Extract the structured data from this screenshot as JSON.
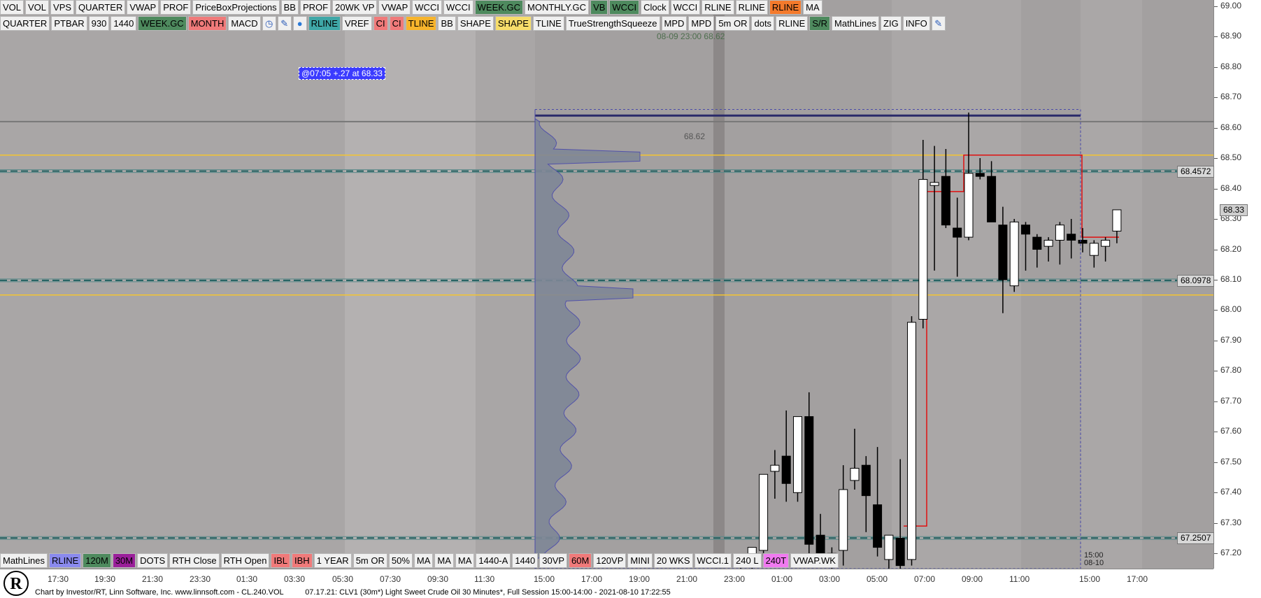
{
  "toolbar_top": [
    "VOL",
    "VOL",
    "VPS",
    "QUARTER",
    "VWAP",
    "PROF",
    "PriceBoxProjections",
    "BB",
    "PROF",
    "20WK VP",
    "VWAP",
    "WCCI",
    "WCCI",
    "WEEK.GC",
    "MONTHLY.GC",
    "VB",
    "WCCI",
    "Clock",
    "WCCI",
    "RLINE",
    "RLINE",
    "RLINE",
    "MA"
  ],
  "toolbar_top_colors": [
    "#f0f0f0",
    "#f0f0f0",
    "#f0f0f0",
    "#f0f0f0",
    "#f0f0f0",
    "#f0f0f0",
    "#f0f0f0",
    "#f0f0f0",
    "#f0f0f0",
    "#f0f0f0",
    "#f0f0f0",
    "#f0f0f0",
    "#f0f0f0",
    "#4e8a5e",
    "#f0f0f0",
    "#4e8a5e",
    "#4e8a5e",
    "#f0f0f0",
    "#f0f0f0",
    "#f0f0f0",
    "#f0f0f0",
    "#f47a2c",
    "#f0f0f0"
  ],
  "toolbar_second": [
    "QUARTER",
    "PTBAR",
    "930",
    "1440",
    "WEEK.GC",
    "MONTH",
    "MACD",
    "clock-icon",
    "pen-icon",
    "drop-icon",
    "RLINE",
    "VREF",
    "CI",
    "CI",
    "TLINE",
    "BB",
    "SHAPE",
    "SHAPE",
    "TLINE",
    "TrueStrengthSqueeze",
    "MPD",
    "MPD",
    "5m OR",
    "dots",
    "RLINE",
    "S/R",
    "MathLines",
    "ZIG",
    "INFO",
    "edit-icon"
  ],
  "toolbar_second_colors": [
    "#f0f0f0",
    "#f0f0f0",
    "#f0f0f0",
    "#f0f0f0",
    "#4e8a5e",
    "#f07a7a",
    "#f0f0f0",
    "#f0f0f0",
    "#f0f0f0",
    "#f0f0f0",
    "#3fa7a7",
    "#f0f0f0",
    "#f07a7a",
    "#f07a7a",
    "#f7b42c",
    "#f0f0f0",
    "#f0f0f0",
    "#f7dd6a",
    "#f0f0f0",
    "#f0f0f0",
    "#f0f0f0",
    "#f0f0f0",
    "#f0f0f0",
    "#f0f0f0",
    "#f0f0f0",
    "#4e8a5e",
    "#f0f0f0",
    "#f0f0f0",
    "#f0f0f0",
    "#f0f0f0"
  ],
  "toolbar_bottom": [
    "MathLines",
    "RLINE",
    "120M",
    "30M",
    "DOTS",
    "RTH Close",
    "RTH Open",
    "IBL",
    "IBH",
    "1 YEAR",
    "5m OR",
    "50%",
    "MA",
    "MA",
    "MA",
    "1440-A",
    "1440",
    "30VP",
    "60M",
    "120VP",
    "MINI",
    "20 WKS",
    "WCCI.1",
    "240 L",
    "240T",
    "VWAP.WK"
  ],
  "toolbar_bottom_colors": [
    "#f0f0f0",
    "#8a8aee",
    "#4e8a5e",
    "#9a1f9a",
    "#f0f0f0",
    "#f0f0f0",
    "#f0f0f0",
    "#f07a7a",
    "#f07a7a",
    "#f0f0f0",
    "#f0f0f0",
    "#f0f0f0",
    "#f0f0f0",
    "#f0f0f0",
    "#f0f0f0",
    "#f0f0f0",
    "#f0f0f0",
    "#f0f0f0",
    "#f07a7a",
    "#f0f0f0",
    "#f0f0f0",
    "#f0f0f0",
    "#f0f0f0",
    "#f0f0f0",
    "#f07af0",
    "#f0f0f0"
  ],
  "window_controls": [
    "⧉",
    "✕"
  ],
  "annotation_box": "@07:05  +.27 at 68.33",
  "crosshair_label": "08-09 23:00  68.62",
  "profile_high_label": "68.62",
  "time_marker": [
    "15:00",
    "08-10"
  ],
  "status_text": "Chart by Investor/RT, Linn Software, Inc. www.linnsoft.com - CL.240.VOL",
  "status_text_2": "07.17.21: CLV1 (30m*) Light Sweet Crude Oil 30 Minutes*, Full Session 15:00-14:00 - 2021-08-10 17:22:55",
  "price_tags": [
    {
      "label": "68.4572",
      "price": 68.4572,
      "bg": "#d8d8d8"
    },
    {
      "label": "68.33",
      "price": 68.33,
      "bg": "#cfcfcf"
    },
    {
      "label": "68.0978",
      "price": 68.0978,
      "bg": "#d8d8d8"
    },
    {
      "label": "67.2507",
      "price": 67.2507,
      "bg": "#d8d8d8"
    }
  ],
  "chart_data": {
    "type": "candlestick",
    "instrument": "CLV1 (30m*) Light Sweet Crude Oil 30 Minutes*",
    "ylim": [
      67.15,
      69.02
    ],
    "y_ticks": [
      "69.00",
      "68.90",
      "68.80",
      "68.70",
      "68.60",
      "68.50",
      "68.40",
      "68.30",
      "68.20",
      "68.10",
      "68.00",
      "67.90",
      "67.80",
      "67.70",
      "67.60",
      "67.50",
      "67.40",
      "67.30",
      "67.20"
    ],
    "x_ticks": [
      "17:30",
      "19:30",
      "21:30",
      "23:30",
      "01:30",
      "03:30",
      "05:30",
      "07:30",
      "09:30",
      "11:30",
      "15:00",
      "17:00",
      "19:00",
      "21:00",
      "23:00",
      "01:00",
      "03:00",
      "05:00",
      "07:00",
      "09:00",
      "11:00",
      "15:00",
      "17:00"
    ],
    "candles": [
      {
        "o": 67.16,
        "h": 67.17,
        "l": 67.15,
        "c": 67.17
      },
      {
        "o": 67.18,
        "h": 67.22,
        "l": 67.15,
        "c": 67.22
      },
      {
        "o": 67.21,
        "h": 67.46,
        "l": 67.19,
        "c": 67.46
      },
      {
        "o": 67.47,
        "h": 67.54,
        "l": 67.38,
        "c": 67.49
      },
      {
        "o": 67.52,
        "h": 67.67,
        "l": 67.37,
        "c": 67.43
      },
      {
        "o": 67.4,
        "h": 67.65,
        "l": 67.37,
        "c": 67.65
      },
      {
        "o": 67.65,
        "h": 67.73,
        "l": 67.18,
        "c": 67.23
      },
      {
        "o": 67.26,
        "h": 67.33,
        "l": 67.16,
        "c": 67.17
      },
      {
        "o": 67.17,
        "h": 67.22,
        "l": 67.15,
        "c": 67.2
      },
      {
        "o": 67.21,
        "h": 67.49,
        "l": 67.16,
        "c": 67.41
      },
      {
        "o": 67.44,
        "h": 67.61,
        "l": 67.41,
        "c": 67.48
      },
      {
        "o": 67.49,
        "h": 67.52,
        "l": 67.27,
        "c": 67.39
      },
      {
        "o": 67.36,
        "h": 67.55,
        "l": 67.19,
        "c": 67.22
      },
      {
        "o": 67.18,
        "h": 67.26,
        "l": 67.15,
        "c": 67.26
      },
      {
        "o": 67.25,
        "h": 67.51,
        "l": 67.15,
        "c": 67.16
      },
      {
        "o": 67.18,
        "h": 67.98,
        "l": 67.16,
        "c": 67.96
      },
      {
        "o": 67.97,
        "h": 68.56,
        "l": 67.94,
        "c": 68.43
      },
      {
        "o": 68.41,
        "h": 68.54,
        "l": 68.13,
        "c": 68.42
      },
      {
        "o": 68.44,
        "h": 68.53,
        "l": 68.27,
        "c": 68.28
      },
      {
        "o": 68.27,
        "h": 68.37,
        "l": 68.11,
        "c": 68.24
      },
      {
        "o": 68.24,
        "h": 68.65,
        "l": 68.23,
        "c": 68.45
      },
      {
        "o": 68.45,
        "h": 68.5,
        "l": 68.43,
        "c": 68.44
      },
      {
        "o": 68.44,
        "h": 68.49,
        "l": 68.29,
        "c": 68.29
      },
      {
        "o": 68.28,
        "h": 68.34,
        "l": 67.99,
        "c": 68.1
      },
      {
        "o": 68.08,
        "h": 68.3,
        "l": 68.06,
        "c": 68.29
      },
      {
        "o": 68.28,
        "h": 68.29,
        "l": 68.13,
        "c": 68.25
      },
      {
        "o": 68.24,
        "h": 68.25,
        "l": 68.14,
        "c": 68.2
      },
      {
        "o": 68.21,
        "h": 68.24,
        "l": 68.16,
        "c": 68.23
      },
      {
        "o": 68.23,
        "h": 68.29,
        "l": 68.15,
        "c": 68.28
      },
      {
        "o": 68.25,
        "h": 68.3,
        "l": 68.17,
        "c": 68.23
      },
      {
        "o": 68.23,
        "h": 68.27,
        "l": 68.19,
        "c": 68.22
      },
      {
        "o": 68.18,
        "h": 68.23,
        "l": 68.14,
        "c": 68.22
      },
      {
        "o": 68.21,
        "h": 68.24,
        "l": 68.16,
        "c": 68.23
      },
      {
        "o": 68.26,
        "h": 68.33,
        "l": 68.22,
        "c": 68.33
      }
    ],
    "horizontal_lines": [
      {
        "price": 68.4572,
        "color": "#1f5f5f",
        "style": "dashed"
      },
      {
        "price": 68.0978,
        "color": "#1f5f5f",
        "style": "dashed"
      },
      {
        "price": 67.2507,
        "color": "#1f5f5f",
        "style": "dashed"
      },
      {
        "price": 68.51,
        "color": "#f4c430",
        "style": "solid"
      },
      {
        "price": 68.05,
        "color": "#f4c430",
        "style": "solid"
      },
      {
        "price": 68.64,
        "color": "#2a2a6a",
        "style": "solid"
      }
    ],
    "crosshair_price": 68.62,
    "last_price": 68.33
  }
}
